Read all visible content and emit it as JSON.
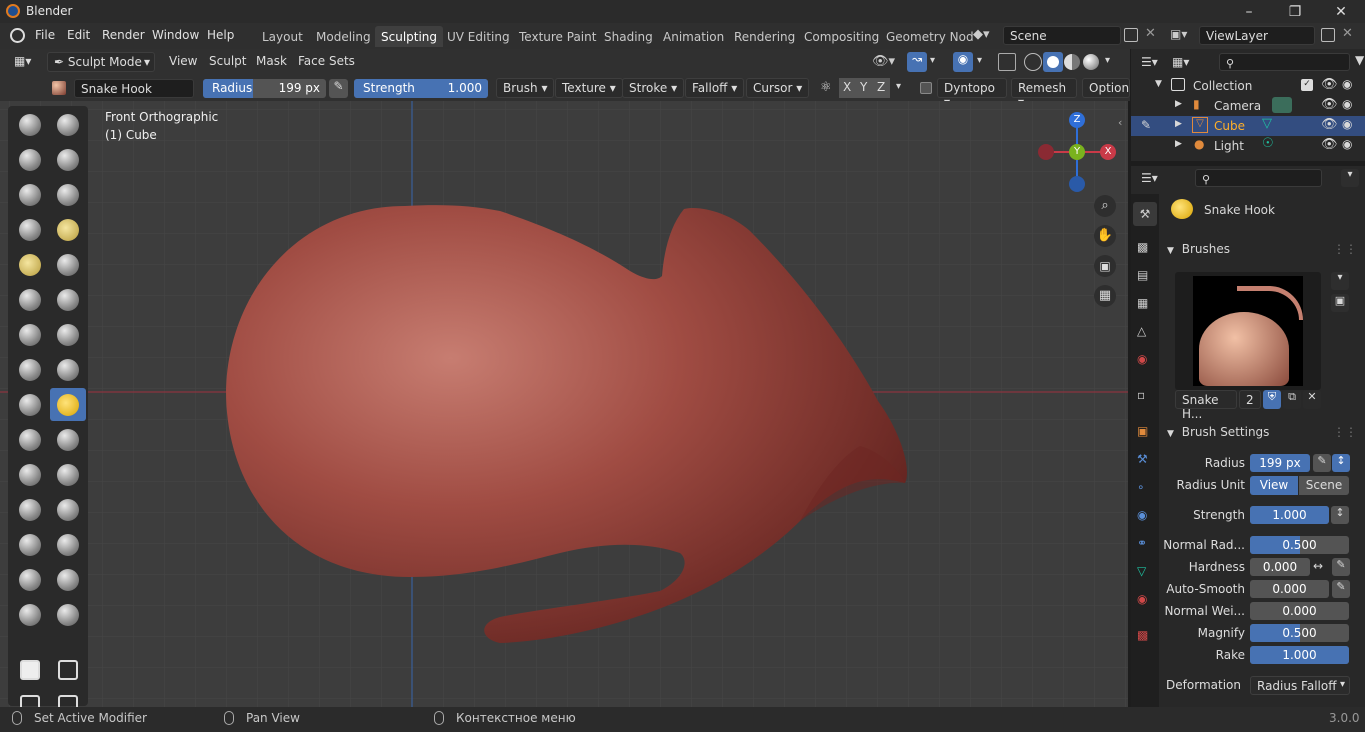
{
  "app": {
    "title": "Blender",
    "version": "3.0.0"
  },
  "menu": [
    "File",
    "Edit",
    "Render",
    "Window",
    "Help"
  ],
  "workspaces": [
    {
      "label": "Layout",
      "active": false
    },
    {
      "label": "Modeling",
      "active": false
    },
    {
      "label": "Sculpting",
      "active": true
    },
    {
      "label": "UV Editing",
      "active": false
    },
    {
      "label": "Texture Paint",
      "active": false
    },
    {
      "label": "Shading",
      "active": false
    },
    {
      "label": "Animation",
      "active": false
    },
    {
      "label": "Rendering",
      "active": false
    },
    {
      "label": "Compositing",
      "active": false
    },
    {
      "label": "Geometry Nod",
      "active": false
    }
  ],
  "scene": {
    "name": "Scene",
    "view_layer": "ViewLayer"
  },
  "header": {
    "mode": "Sculpt Mode",
    "menus": [
      "View",
      "Sculpt",
      "Mask",
      "Face Sets"
    ]
  },
  "tool_settings": {
    "brush_name": "Snake Hook",
    "radius_label": "Radius",
    "radius_value": "199 px",
    "strength_label": "Strength",
    "strength_value": "1.000",
    "strength_fraction": 1.0,
    "dropdowns": [
      "Brush",
      "Texture",
      "Stroke",
      "Falloff",
      "Cursor"
    ],
    "axes": [
      "X",
      "Y",
      "Z"
    ],
    "dyntopo": "Dyntopo",
    "remesh": "Remesh",
    "options": "Options"
  },
  "viewport": {
    "view_name": "Front Orthographic",
    "object_name": "(1) Cube",
    "gizmo": {
      "z": "Z",
      "y": "Y",
      "x": "X"
    }
  },
  "outliner": {
    "collection": "Collection",
    "items": [
      {
        "name": "Camera",
        "selected": false
      },
      {
        "name": "Cube",
        "selected": true
      },
      {
        "name": "Light",
        "selected": false
      }
    ]
  },
  "properties": {
    "brush_name": "Snake Hook",
    "brushes_panel": "Brushes",
    "brush_slot_name": "Snake H...",
    "brush_users": "2",
    "settings_panel": "Brush Settings",
    "radius": {
      "label": "Radius",
      "value": "199 px"
    },
    "radius_unit": {
      "label": "Radius Unit",
      "options": [
        "View",
        "Scene"
      ],
      "selected": "View"
    },
    "strength": {
      "label": "Strength",
      "value": "1.000",
      "fraction": 1.0
    },
    "normal_radius": {
      "label": "Normal Rad...",
      "value": "0.500",
      "fraction": 0.5
    },
    "hardness": {
      "label": "Hardness",
      "value": "0.000"
    },
    "auto_smooth": {
      "label": "Auto-Smooth",
      "value": "0.000"
    },
    "normal_weight": {
      "label": "Normal Wei...",
      "value": "0.000"
    },
    "magnify": {
      "label": "Magnify",
      "value": "0.500",
      "fraction": 0.5
    },
    "rake": {
      "label": "Rake",
      "value": "1.000",
      "fraction": 1.0
    },
    "deformation": {
      "label": "Deformation",
      "value": "Radius Falloff"
    }
  },
  "status": {
    "left": "Set Active Modifier",
    "middle": "Pan View",
    "right": "Контекстное меню"
  },
  "colors": {
    "accent": "#4772b3",
    "selected_tool": "#4772b3",
    "mesh": "#9a4a42",
    "x_axis": "#c93a48",
    "y_axis": "#7ab21e",
    "z_axis": "#2f6fd8"
  }
}
